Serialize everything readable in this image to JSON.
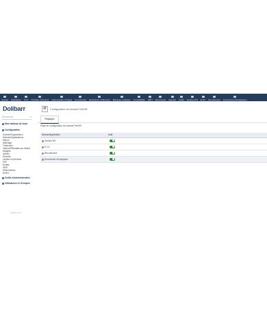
{
  "topmenu": [
    {
      "label": "Accueil"
    },
    {
      "label": "Sollicitants"
    },
    {
      "label": "Tiers"
    },
    {
      "label": "Produits | Services"
    },
    {
      "label": "Opportunités | Projets"
    },
    {
      "label": "Commercial"
    },
    {
      "label": "Facturation | Paiement"
    },
    {
      "label": "Banques | Caisses"
    },
    {
      "label": "Comptabilité"
    },
    {
      "label": "GRH"
    },
    {
      "label": "Documents"
    },
    {
      "label": "Agenda"
    },
    {
      "label": "Outils"
    },
    {
      "label": "Gestion RH"
    },
    {
      "label": "E-CV"
    },
    {
      "label": "Recrutement"
    },
    {
      "label": "Documents d'employeurs"
    }
  ],
  "sidebar": {
    "logo": "Dolibarr",
    "search_placeholder": "Rechercher",
    "home": "Mon tableau de bord",
    "config_head": "Configuration",
    "links": [
      "Société/Organisation",
      "Modules/Applications",
      "Menus",
      "Affichage",
      "Traduction",
      "Valeurs/Résultats par défaut",
      "Widgets",
      "Alertes",
      "Sécurité",
      "Limites et précision",
      "PDF",
      "Emails",
      "SMS",
      "Dictionnaires",
      "Divers"
    ],
    "tools_head": "Outils d'administration",
    "users_head": "Utilisateurs & Groupes",
    "version": "Dolibarr 18.0"
  },
  "main": {
    "title": "Configuration du module PeriHR",
    "tab": "Réglages",
    "subtitle": "Page de configuration du module PeriHR",
    "table": {
      "col_module": "Module/Application",
      "col_active": "Actif",
      "rows": [
        {
          "name": "Gestion RH",
          "active": true
        },
        {
          "name": "E-CV",
          "active": true
        },
        {
          "name": "Recrutement",
          "active": true
        },
        {
          "name": "Documents d'employeur",
          "active": true
        }
      ]
    }
  }
}
